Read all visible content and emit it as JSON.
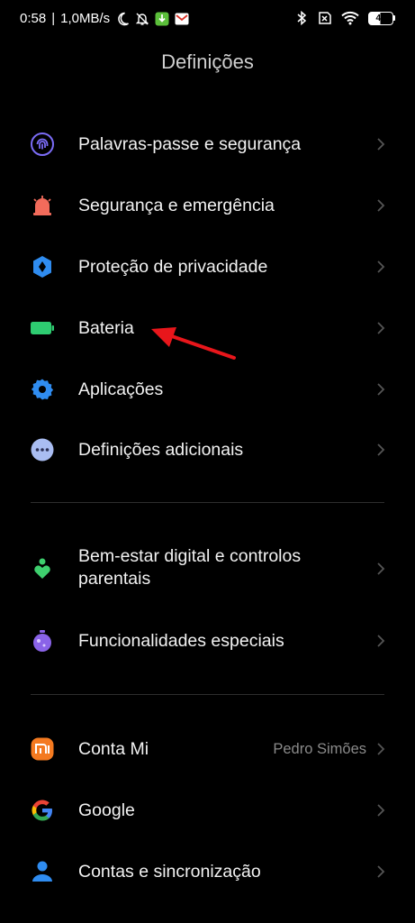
{
  "status_bar": {
    "time": "0:58",
    "separator": "|",
    "speed": "1,0MB/s",
    "battery_level": "49",
    "icons": [
      "moon-icon",
      "bell-off-icon",
      "download-app-icon",
      "gmail-icon",
      "bluetooth-icon",
      "no-sim-icon",
      "wifi-icon",
      "battery-icon"
    ]
  },
  "header": {
    "title": "Definições"
  },
  "colors": {
    "background": "#000000",
    "text": "#f2f2f2",
    "secondary_text": "#8a8a8a",
    "passwords_icon": "#7b6cf6",
    "emergency_icon": "#f26b5b",
    "privacy_icon": "#2f8cf0",
    "battery_icon": "#2ecc71",
    "apps_icon": "#2f8cf0",
    "additional_icon": "#a9bdf2",
    "wellbeing_icon": "#3ecf6e",
    "special_icon": "#8a63e8",
    "mi_icon": "#f47a20",
    "accounts_icon": "#2f8cf0",
    "arrow": "#e8161b"
  },
  "sections": [
    {
      "items": [
        {
          "label": "Palavras-passe e segurança",
          "icon": "fingerprint-icon"
        },
        {
          "label": "Segurança e emergência",
          "icon": "emergency-light-icon"
        },
        {
          "label": "Proteção de privacidade",
          "icon": "privacy-shield-icon"
        },
        {
          "label": "Bateria",
          "icon": "battery-icon"
        },
        {
          "label": "Aplicações",
          "icon": "gear-icon"
        },
        {
          "label": "Definições adicionais",
          "icon": "more-dots-icon"
        }
      ]
    },
    {
      "items": [
        {
          "label": "Bem-estar digital e controlos parentais",
          "icon": "wellbeing-icon"
        },
        {
          "label": "Funcionalidades especiais",
          "icon": "potion-icon"
        }
      ]
    },
    {
      "items": [
        {
          "label": "Conta Mi",
          "value": "Pedro Simões",
          "icon": "mi-icon"
        },
        {
          "label": "Google",
          "icon": "google-icon"
        },
        {
          "label": "Contas e sincronização",
          "icon": "person-icon"
        }
      ]
    }
  ]
}
